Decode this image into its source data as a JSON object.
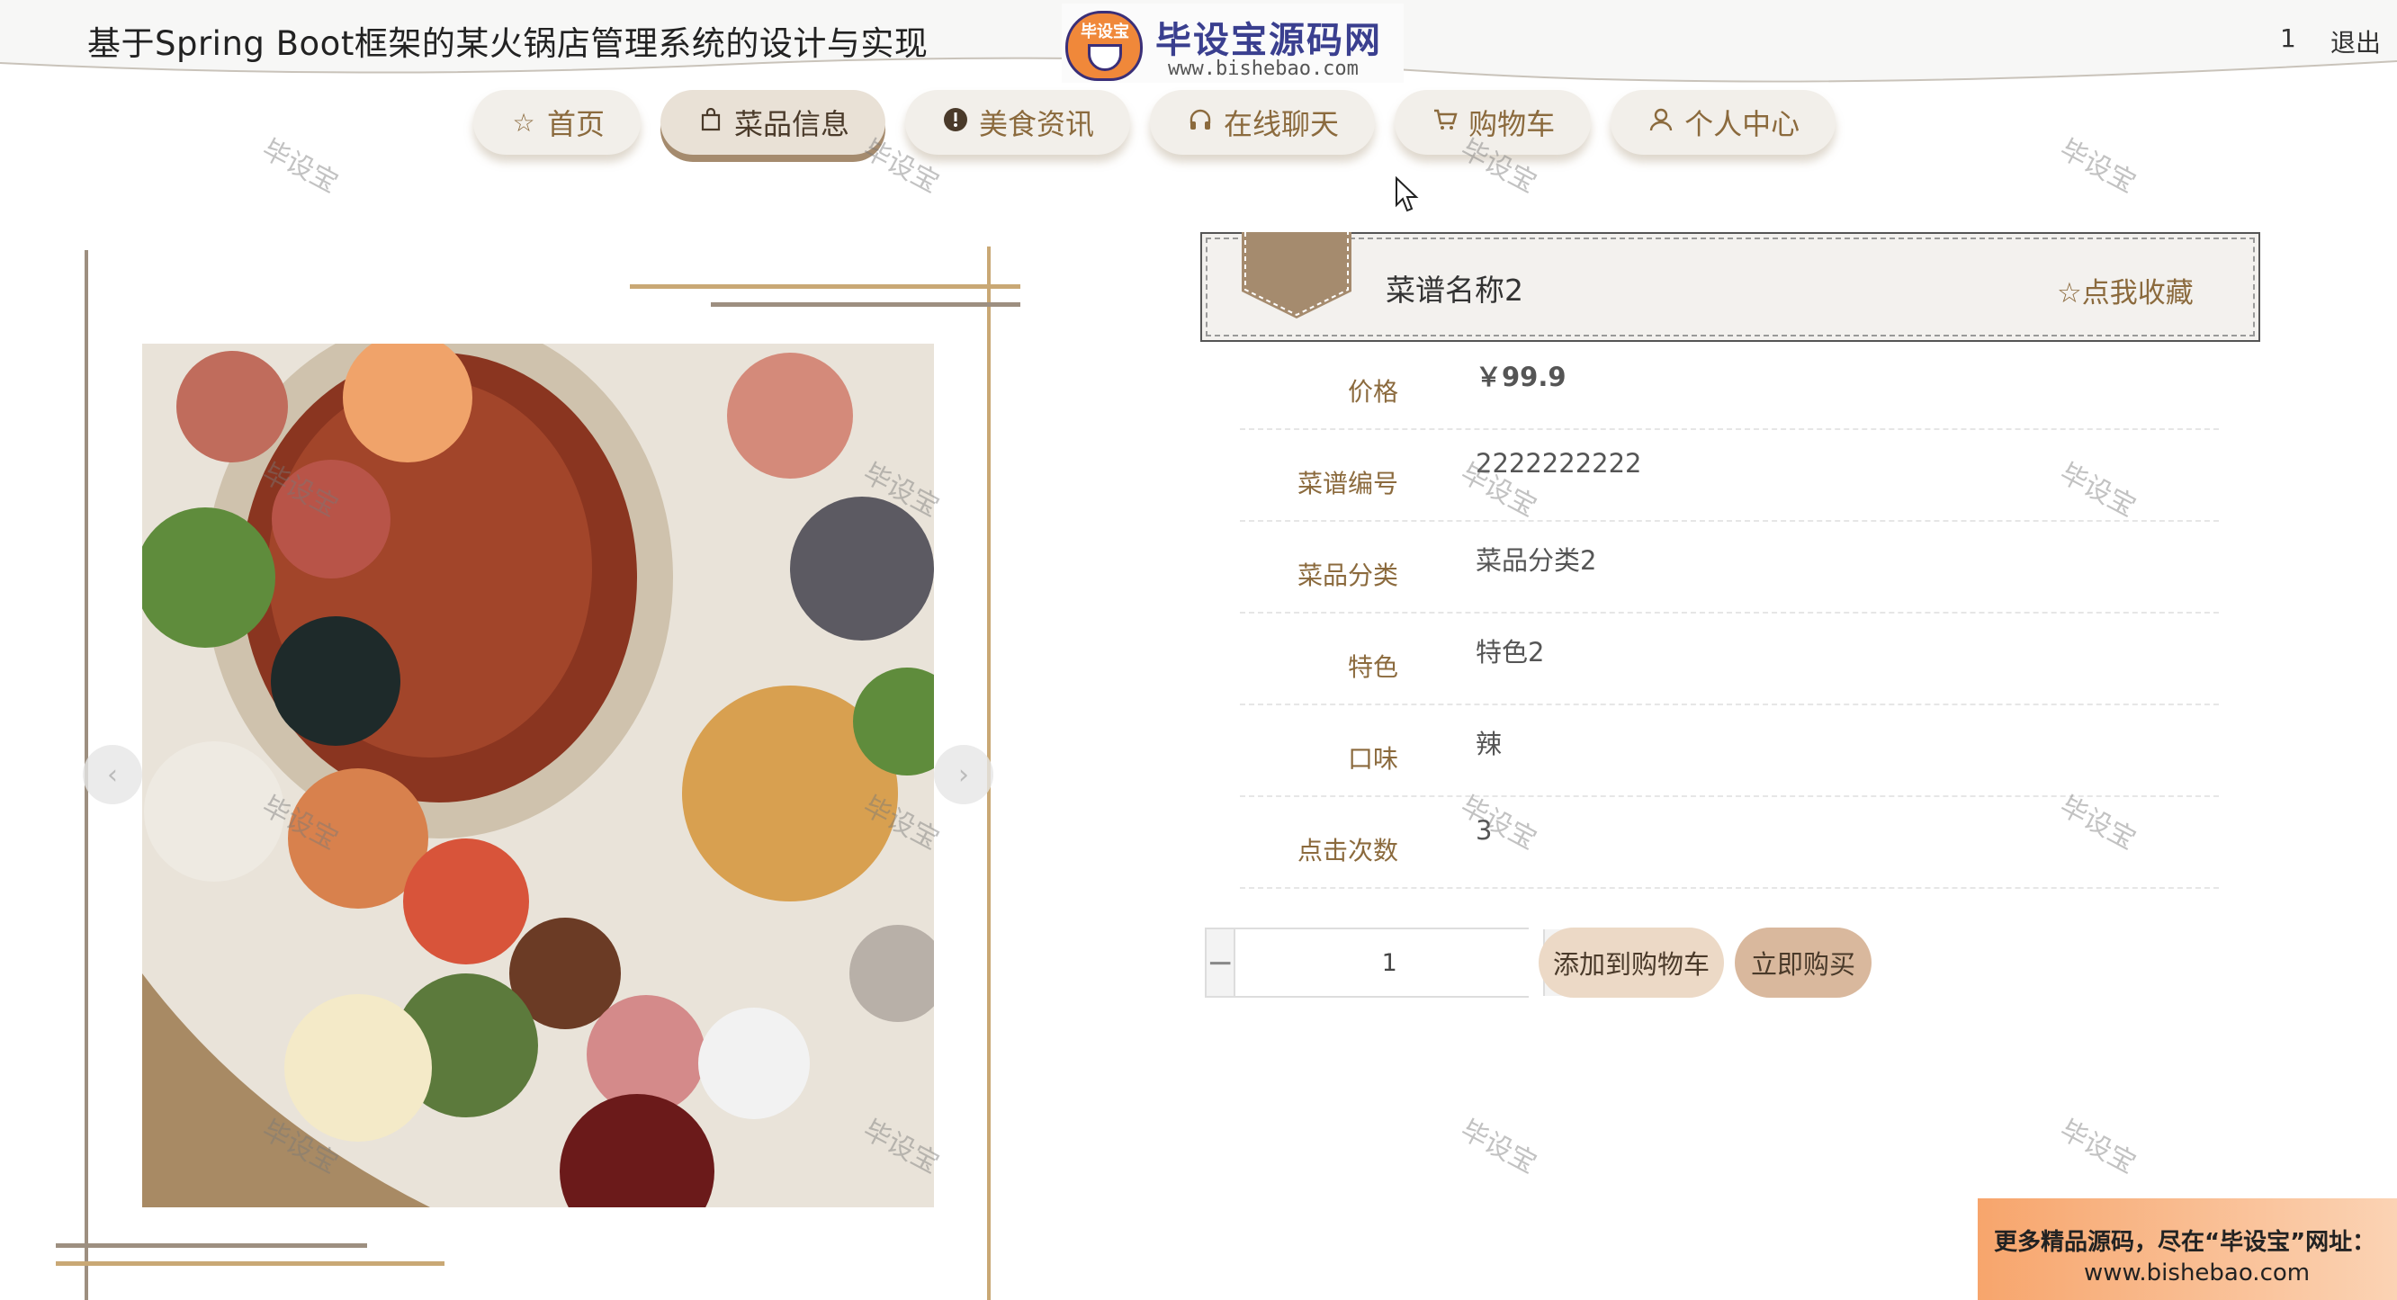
{
  "header": {
    "title": "基于Spring Boot框架的某火锅店管理系统的设计与实现",
    "logo_badge": "毕设宝",
    "logo_text": "毕设宝源码网",
    "logo_url": "www.bishebao.com",
    "user": "1",
    "logout": "退出"
  },
  "nav": {
    "items": [
      {
        "label": "首页",
        "icon": "star-icon"
      },
      {
        "label": "菜品信息",
        "icon": "bag-icon",
        "active": true
      },
      {
        "label": "美食资讯",
        "icon": "alert-circle-icon"
      },
      {
        "label": "在线聊天",
        "icon": "headset-icon"
      },
      {
        "label": "购物车",
        "icon": "cart-icon"
      },
      {
        "label": "个人中心",
        "icon": "user-icon"
      }
    ]
  },
  "watermark": "毕设宝",
  "gallery": {
    "prev": "‹",
    "next": "›"
  },
  "detail": {
    "name": "菜谱名称2",
    "favorite": "☆点我收藏",
    "fields": [
      {
        "label": "价格",
        "value": "￥99.9"
      },
      {
        "label": "菜谱编号",
        "value": "2222222222"
      },
      {
        "label": "菜品分类",
        "value": "菜品分类2"
      },
      {
        "label": "特色",
        "value": "特色2"
      },
      {
        "label": "口味",
        "value": "辣"
      },
      {
        "label": "点击次数",
        "value": "3"
      }
    ]
  },
  "purchase": {
    "minus": "−",
    "quantity": "1",
    "plus": "+",
    "add_to_cart": "添加到购物车",
    "buy_now": "立即购买"
  },
  "ad": {
    "line1": "更多精品源码，尽在“毕设宝”网址：",
    "line2": "www.bishebao.com"
  },
  "colors": {
    "accent": "#8b6a3d",
    "nav_bg": "#f2efea",
    "cart_button": "#ecd9c6",
    "buy_button": "#d9b89d",
    "flag": "#a58b6e"
  }
}
